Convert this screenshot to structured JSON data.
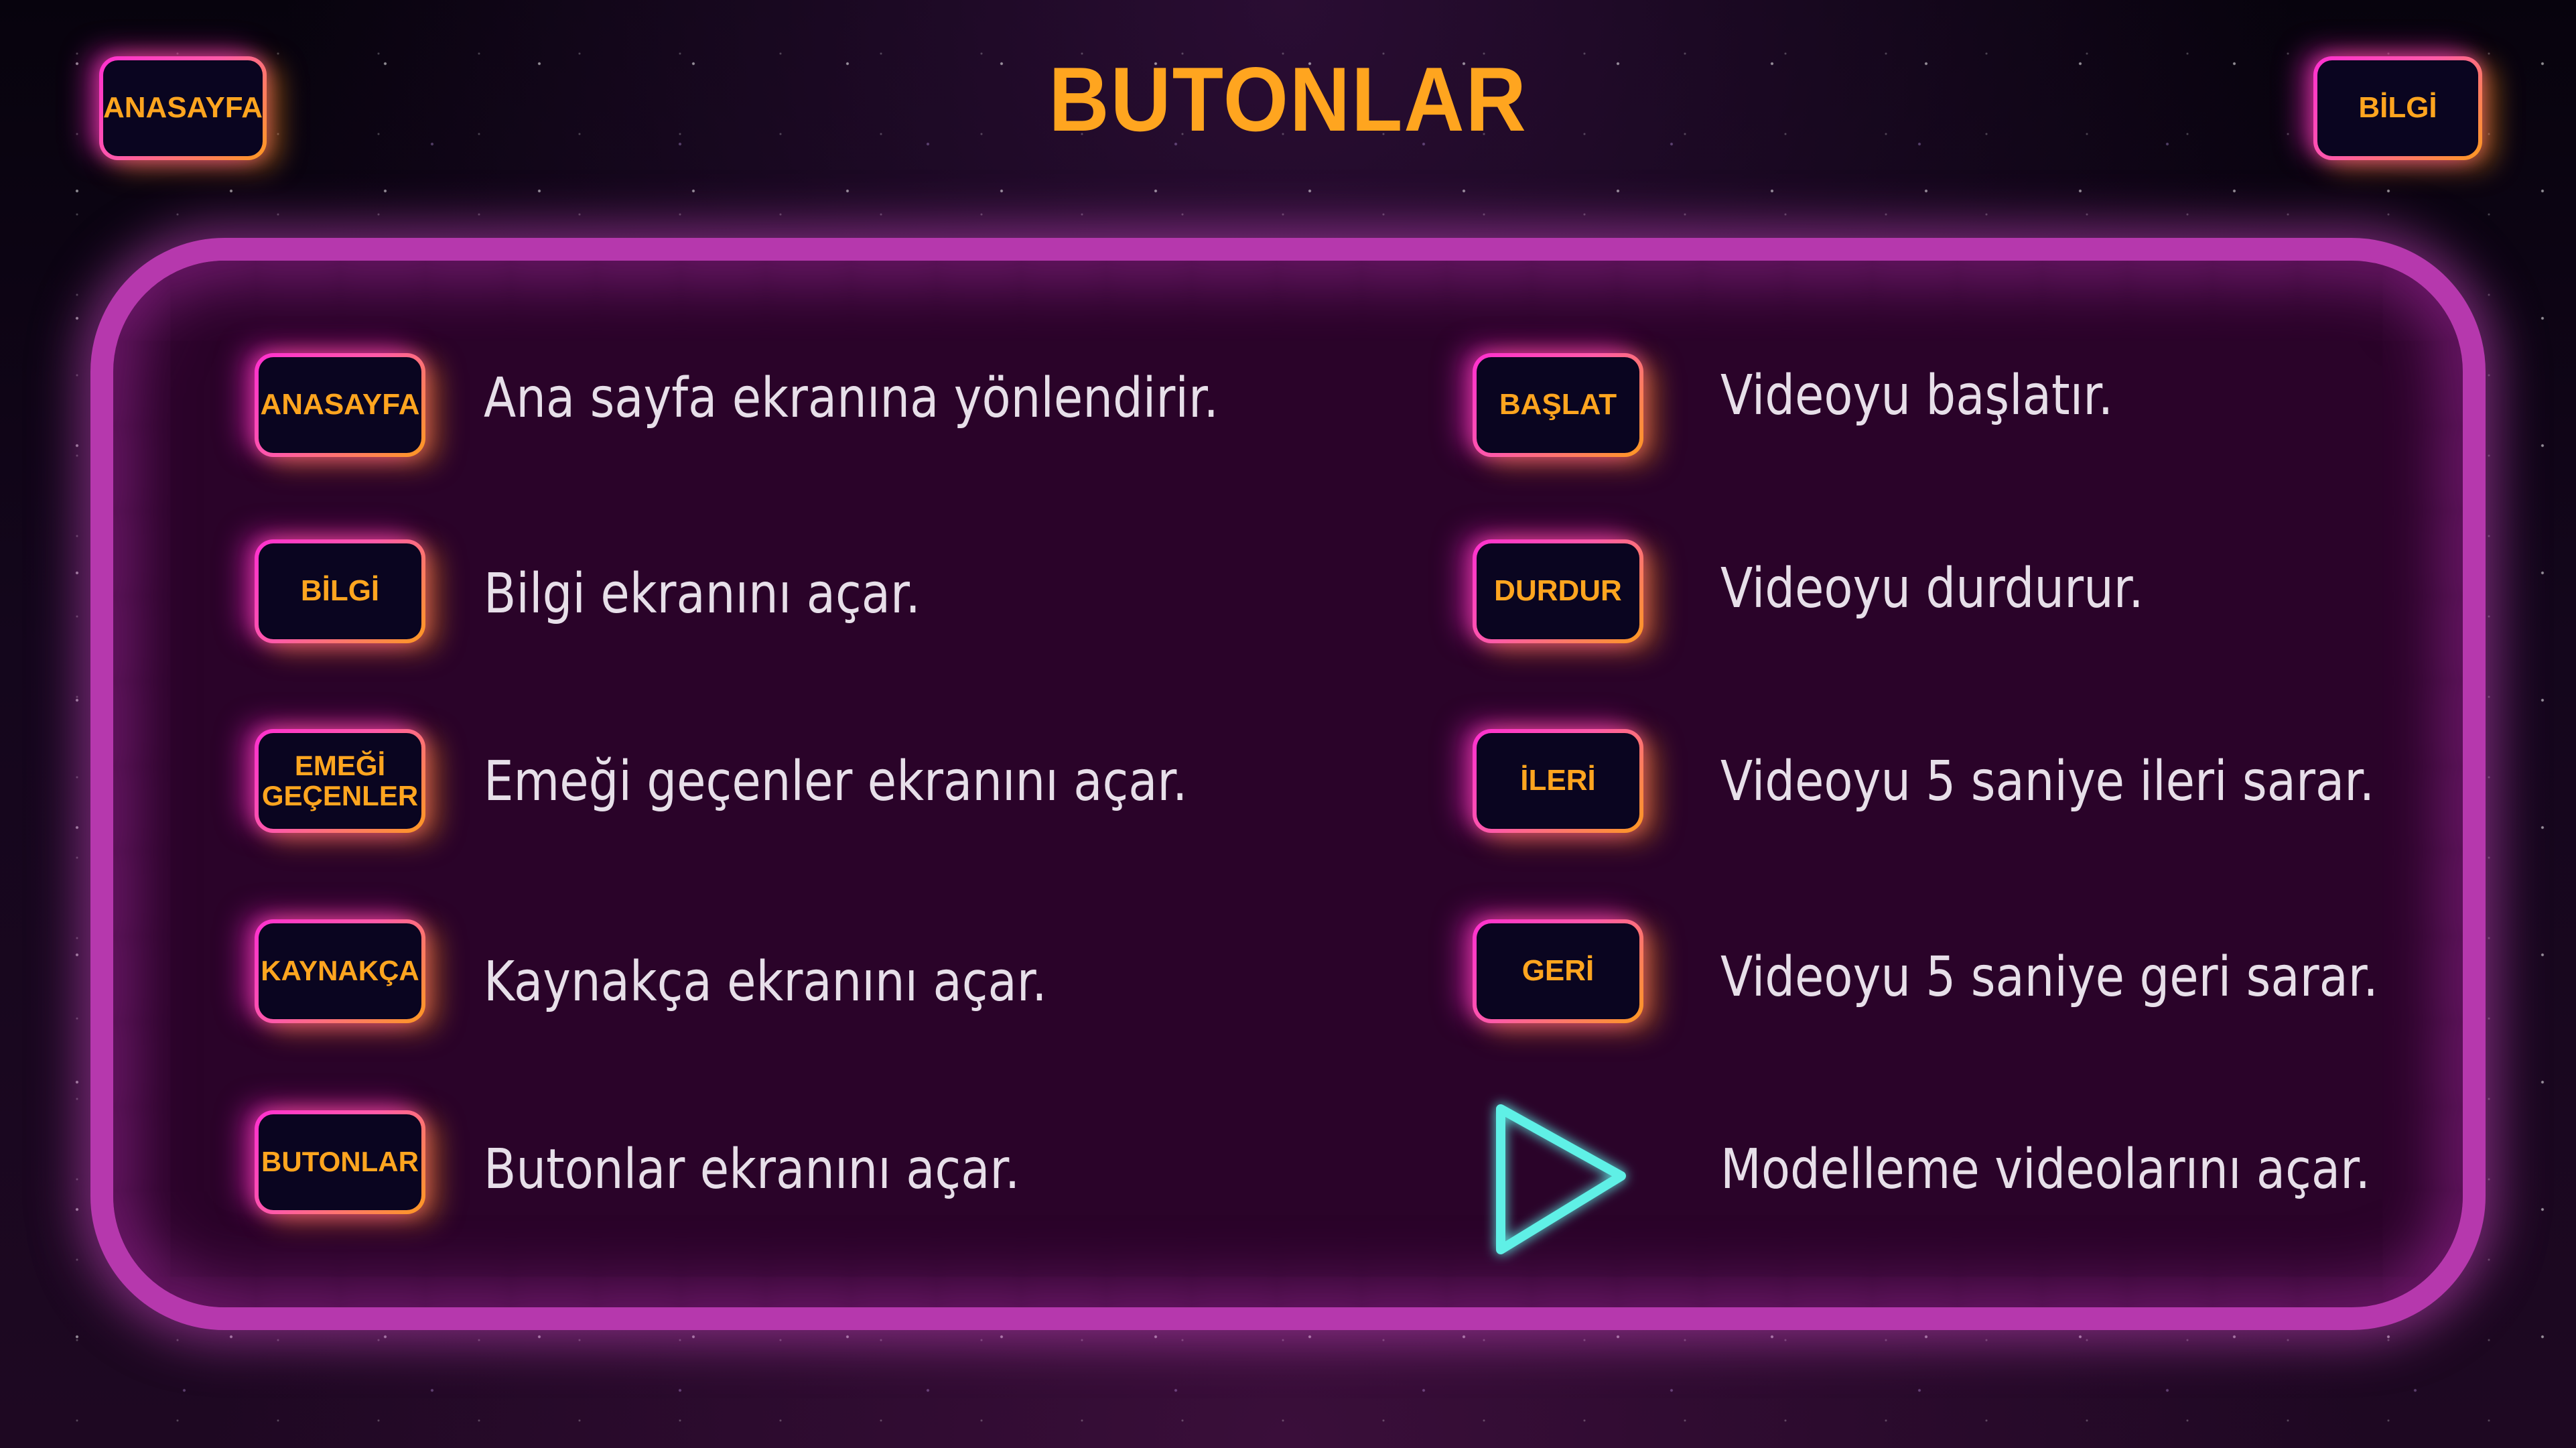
{
  "page": {
    "title": "BUTONLAR"
  },
  "header": {
    "home_button": "ANASAYFA",
    "info_button": "BİLGİ"
  },
  "left_column": [
    {
      "button": "ANASAYFA",
      "description": "Ana sayfa ekranına yönlendirir."
    },
    {
      "button": "BİLGİ",
      "description": "Bilgi ekranını açar."
    },
    {
      "button_line1": "EMEĞİ",
      "button_line2": "GEÇENLER",
      "description": "Emeği geçenler ekranını açar."
    },
    {
      "button": "KAYNAKÇA",
      "description": "Kaynakça ekranını açar."
    },
    {
      "button": "BUTONLAR",
      "description": "Butonlar ekranını açar."
    }
  ],
  "right_column": [
    {
      "button": "BAŞLAT",
      "description": "Videoyu başlatır."
    },
    {
      "button": "DURDUR",
      "description": "Videoyu durdurur."
    },
    {
      "button": "İLERİ",
      "description": "Videoyu 5 saniye ileri sarar."
    },
    {
      "button": "GERİ",
      "description": "Videoyu 5 saniye geri sarar."
    },
    {
      "icon": "play-triangle-icon",
      "description": "Modelleme videolarını açar."
    }
  ],
  "colors": {
    "accent_orange": "#ffa51f",
    "neon_pink": "#ff2fd0",
    "panel_border": "#b638ad",
    "panel_fill": "#2a0329",
    "button_fill": "#0a0520",
    "play_icon": "#5ff0e6",
    "description_text": "#e7dfe9"
  }
}
